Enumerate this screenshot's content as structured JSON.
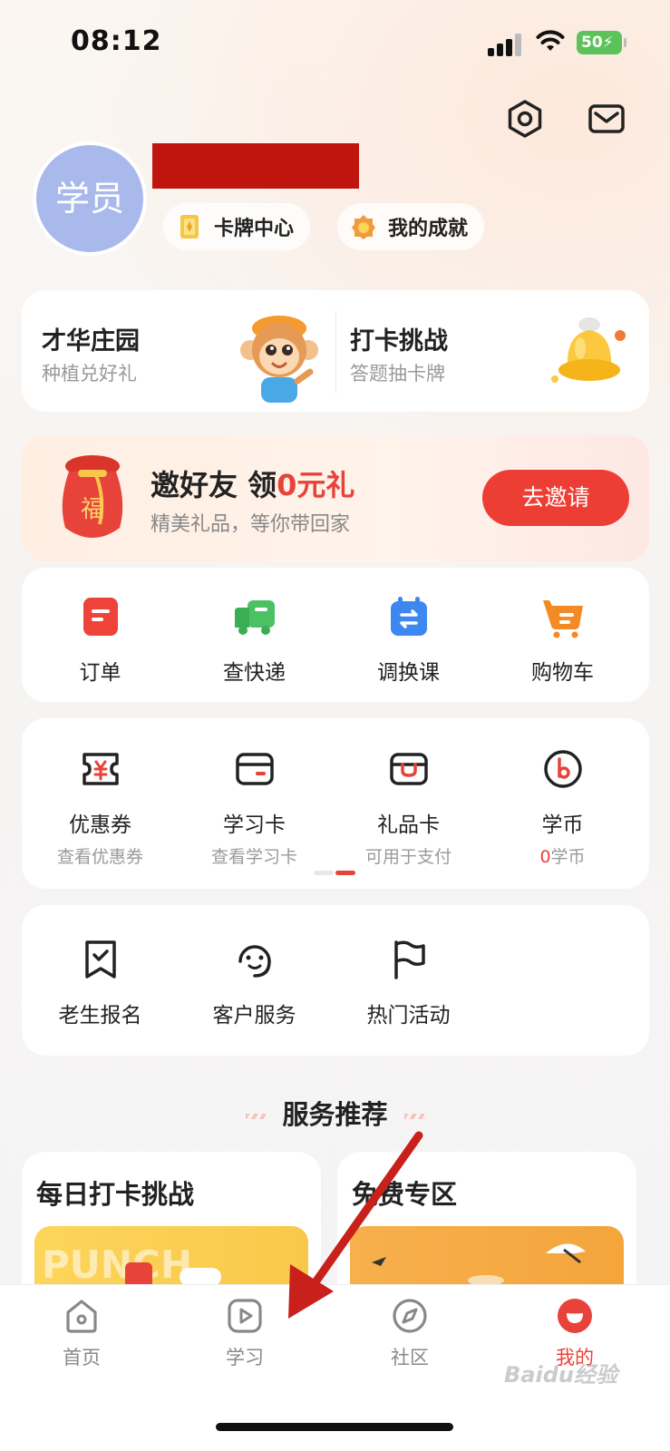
{
  "status_bar": {
    "time": "08:12",
    "battery": "50"
  },
  "profile": {
    "avatar_text": "学员"
  },
  "chips": [
    {
      "label": "卡牌中心"
    },
    {
      "label": "我的成就"
    }
  ],
  "promos": [
    {
      "title": "才华庄园",
      "subtitle": "种植兑好礼"
    },
    {
      "title": "打卡挑战",
      "subtitle": "答题抽卡牌"
    }
  ],
  "invite": {
    "title_prefix": "邀好友 领",
    "title_accent": "0元礼",
    "subtitle": "精美礼品，等你带回家",
    "button": "去邀请",
    "bag_char": "福"
  },
  "order_row": [
    {
      "label": "订单",
      "icon": "order-icon"
    },
    {
      "label": "查快递",
      "icon": "truck-icon"
    },
    {
      "label": "调换课",
      "icon": "calendar-swap-icon"
    },
    {
      "label": "购物车",
      "icon": "cart-icon"
    }
  ],
  "wallet_row": [
    {
      "label": "优惠券",
      "sub": "查看优惠券",
      "icon": "coupon-icon"
    },
    {
      "label": "学习卡",
      "sub": "查看学习卡",
      "icon": "study-card-icon"
    },
    {
      "label": "礼品卡",
      "sub": "可用于支付",
      "icon": "gift-card-icon"
    },
    {
      "label": "学币",
      "sub_accent": "0",
      "sub_rest": "学币",
      "icon": "coin-icon"
    }
  ],
  "service_row": [
    {
      "label": "老生报名",
      "icon": "enroll-icon"
    },
    {
      "label": "客户服务",
      "icon": "customer-service-icon"
    },
    {
      "label": "热门活动",
      "icon": "flag-icon"
    }
  ],
  "section": {
    "title": "服务推荐"
  },
  "recommend": [
    {
      "title": "每日打卡挑战",
      "banner_text": "PUNCH"
    },
    {
      "title": "免费专区"
    }
  ],
  "tabbar": [
    {
      "label": "首页",
      "icon": "home-icon",
      "active": false
    },
    {
      "label": "学习",
      "icon": "play-icon",
      "active": false
    },
    {
      "label": "社区",
      "icon": "compass-icon",
      "active": false
    },
    {
      "label": "我的",
      "icon": "profile-icon",
      "active": true
    }
  ],
  "watermark": "Baidu经验",
  "colors": {
    "accent": "#e8433a",
    "avatar": "#a9b9ec"
  }
}
